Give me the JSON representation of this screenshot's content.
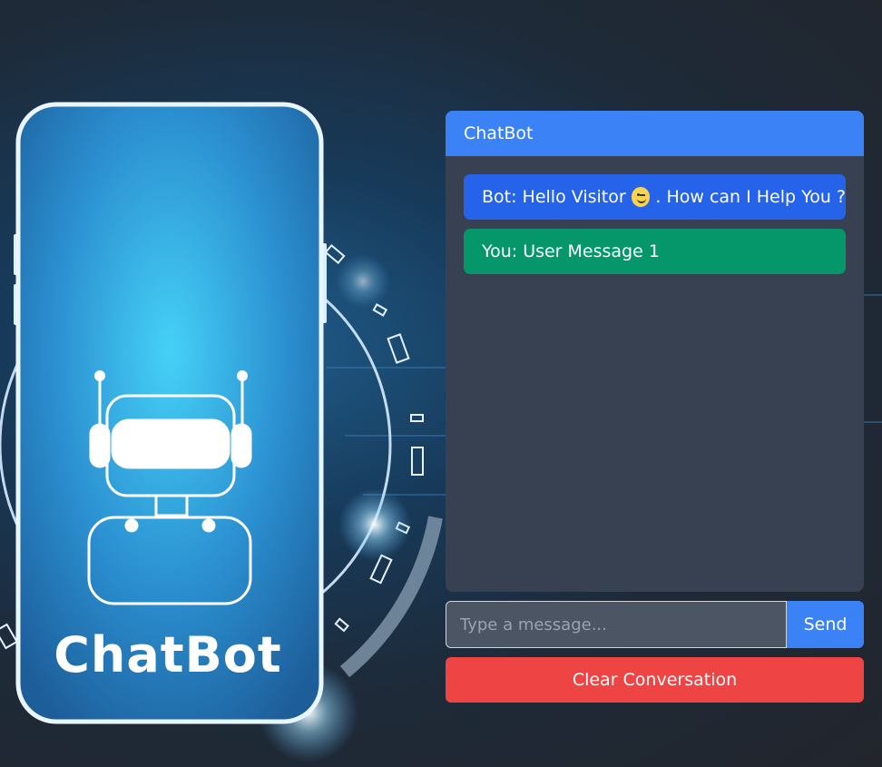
{
  "hero": {
    "logo_text": "ChatBot"
  },
  "chat": {
    "title": "ChatBot",
    "messages": [
      {
        "sender": "bot",
        "prefix": "Bot: Hello Visitor",
        "emoji": "wink-emoji-icon",
        "suffix": ". How can I Help You ?"
      },
      {
        "sender": "user",
        "text": "You: User Message 1"
      }
    ]
  },
  "composer": {
    "placeholder": "Type a message...",
    "send_label": "Send"
  },
  "actions": {
    "clear_label": "Clear Conversation"
  },
  "colors": {
    "header": "#3b82f6",
    "bot_bubble": "#2563eb",
    "user_bubble": "#059669",
    "panel": "#374151",
    "clear_button": "#ef4444"
  }
}
